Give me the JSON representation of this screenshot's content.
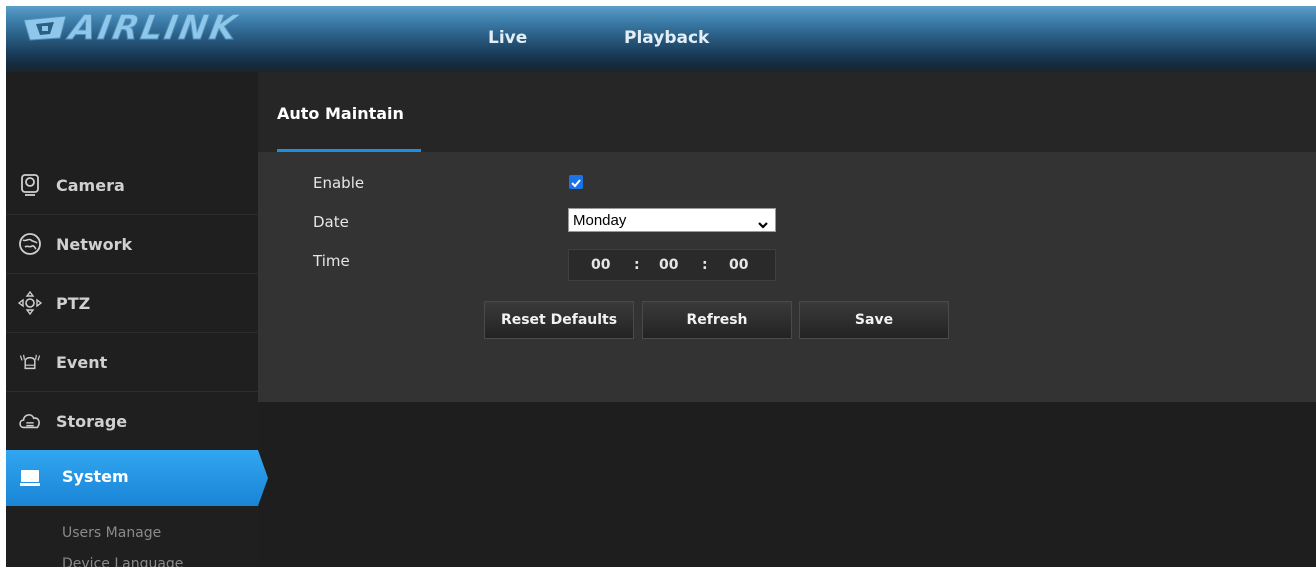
{
  "brand": {
    "name": "AIRLINK"
  },
  "top_nav": {
    "live": "Live",
    "playback": "Playback"
  },
  "sidebar": {
    "items": [
      {
        "label": "Camera",
        "icon": "camera-icon"
      },
      {
        "label": "Network",
        "icon": "globe-network-icon"
      },
      {
        "label": "PTZ",
        "icon": "ptz-arrows-icon"
      },
      {
        "label": "Event",
        "icon": "alarm-bell-icon"
      },
      {
        "label": "Storage",
        "icon": "cloud-storage-icon"
      },
      {
        "label": "System",
        "icon": "monitor-icon",
        "active": true
      }
    ],
    "sub_items": [
      "Users Manage",
      "Device Language"
    ]
  },
  "panel": {
    "tab": "Auto Maintain",
    "form": {
      "enable_label": "Enable",
      "enable_checked": true,
      "date_label": "Date",
      "date_value": "Monday",
      "time_label": "Time",
      "time": {
        "hour": "00",
        "minute": "00",
        "second": "00",
        "separator": ":"
      }
    },
    "buttons": {
      "reset": "Reset Defaults",
      "refresh": "Refresh",
      "save": "Save"
    }
  },
  "colors": {
    "accent": "#1d8fe1",
    "panel_bg": "#333333",
    "app_bg": "#1e1e1e",
    "checkbox": "#1a73e8"
  }
}
